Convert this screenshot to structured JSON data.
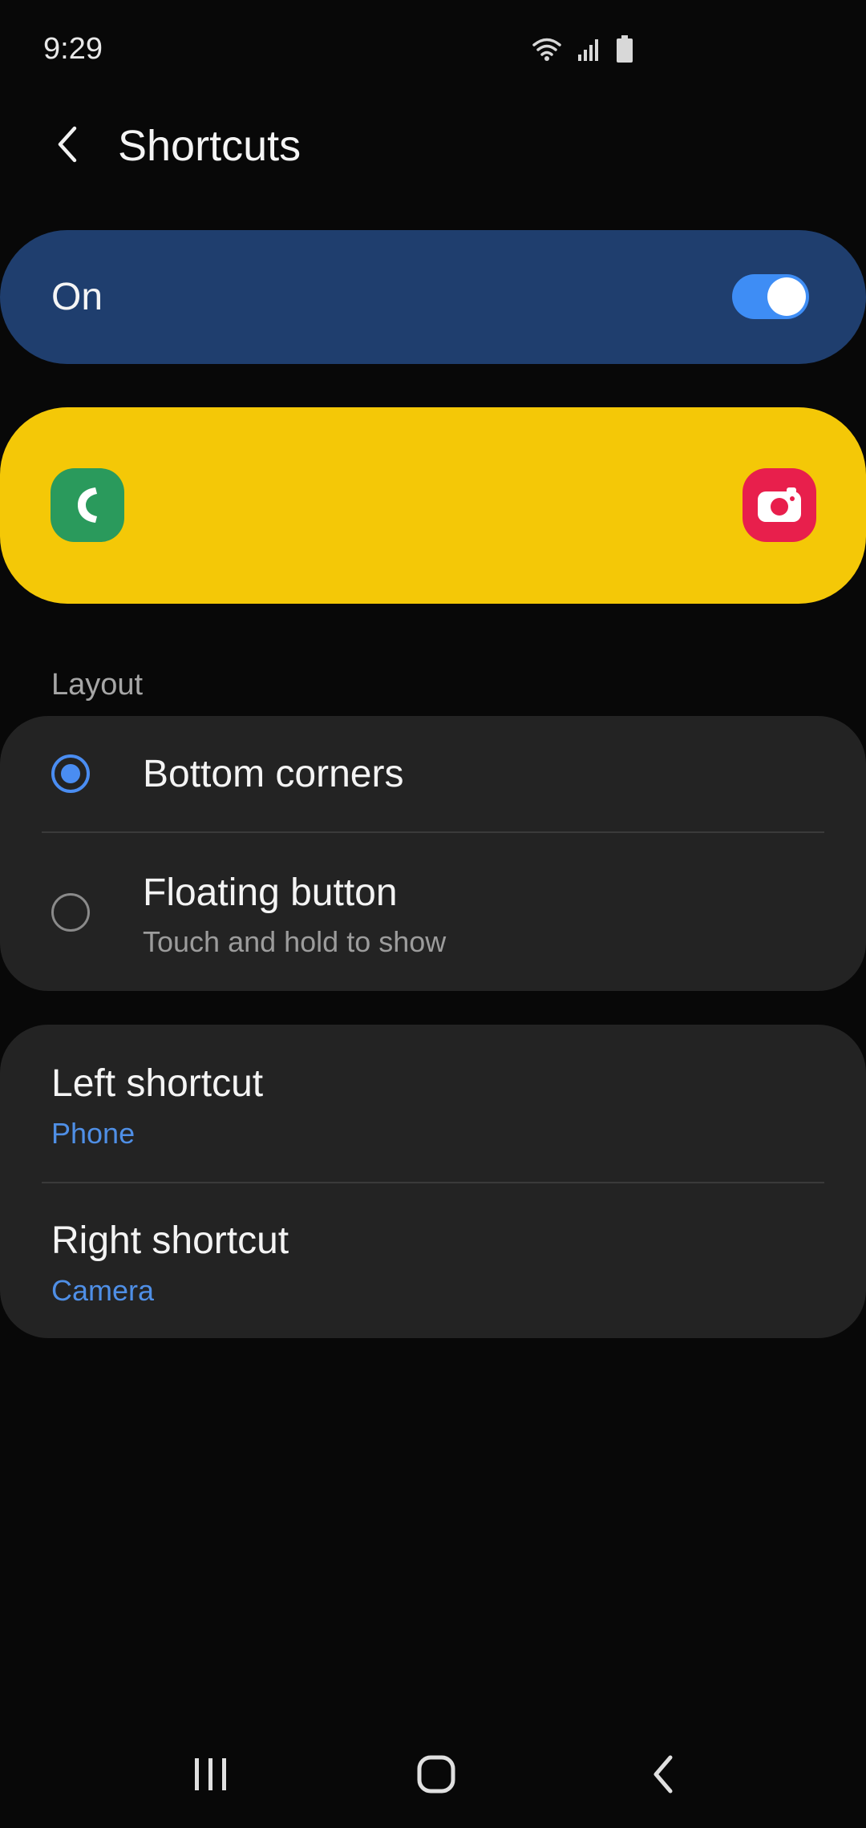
{
  "status_bar": {
    "time": "9:29",
    "icons": [
      "wifi-icon",
      "signal-icon",
      "battery-icon"
    ]
  },
  "app_bar": {
    "title": "Shortcuts",
    "back_icon": "chevron-left-icon"
  },
  "master_switch": {
    "label": "On",
    "state": true
  },
  "preview": {
    "left_app_icon": "phone-icon",
    "right_app_icon": "camera-icon"
  },
  "layout_section": {
    "label": "Layout",
    "options": [
      {
        "title": "Bottom corners",
        "subtitle": "",
        "selected": true
      },
      {
        "title": "Floating button",
        "subtitle": "Touch and hold to show",
        "selected": false
      }
    ]
  },
  "shortcuts": {
    "left": {
      "title": "Left shortcut",
      "value": "Phone"
    },
    "right": {
      "title": "Right shortcut",
      "value": "Camera"
    }
  },
  "nav_bar": {
    "buttons": [
      "recents-icon",
      "home-icon",
      "back-icon"
    ]
  },
  "colors": {
    "master_card": "#1f3e6e",
    "preview_card": "#f4c807",
    "accent": "#4a8df2",
    "card_bg": "#232323"
  }
}
